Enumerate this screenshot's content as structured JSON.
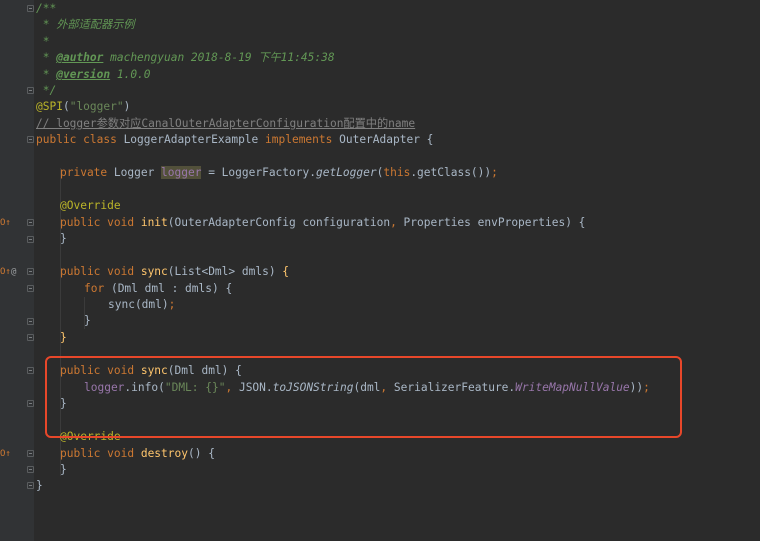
{
  "gutter": {
    "markers": [
      {
        "name": "override-marker-init",
        "text": "O↑"
      },
      {
        "name": "implements-marker-sync",
        "text": "O↑"
      },
      {
        "name": "at-marker-sync",
        "text": "@"
      },
      {
        "name": "override-marker-destroy",
        "text": "O↑"
      }
    ]
  },
  "code": {
    "l1": "/**",
    "l2": " * 外部适配器示例",
    "l3": " *",
    "l4_pre": " * ",
    "l4_tag": "@author",
    "l4_text": " machengyuan 2018-8-19 下午11:45:38",
    "l5_pre": " * ",
    "l5_tag": "@version",
    "l5_text": " 1.0.0",
    "l6": " */",
    "l7_ann": "@SPI",
    "l7_open": "(",
    "l7_str": "\"logger\"",
    "l7_close": ")",
    "l8": "// logger参数对应CanalOuterAdapterConfiguration配置中的name",
    "l9_kw": "public class ",
    "l9_name": "LoggerAdapterExample ",
    "l9_kw2": "implements ",
    "l9_rest": "OuterAdapter {",
    "l11_kw": "private ",
    "l11_type": "Logger ",
    "l11_var": "logger",
    "l11_eq": " = LoggerFactory.",
    "l11_fn": "getLogger",
    "l11_open": "(",
    "l11_this": "this",
    "l11_rest": ".getClass())",
    "l11_semi": ";",
    "l13_ann": "@Override",
    "l14_kw": "public void ",
    "l14_fn": "init",
    "l14_args1": "(OuterAdapterConfig configuration",
    "l14_comma": ", ",
    "l14_args2": "Properties envProperties) {",
    "l15": "}",
    "l17_kw": "public void ",
    "l17_fn": "sync",
    "l17_args": "(List<Dml> dmls) ",
    "l17_brace": "{",
    "l18_kw": "for ",
    "l18_rest": "(Dml dml : dmls) {",
    "l19_call": "sync(dml)",
    "l19_semi": ";",
    "l20": "}",
    "l21": "}",
    "l23_kw": "public void ",
    "l23_fn": "sync",
    "l23_args": "(Dml dml) {",
    "l24_obj": "logger",
    "l24_call": ".info(",
    "l24_str": "\"DML: {}\"",
    "l24_comma": ", ",
    "l24_json": "JSON.",
    "l24_fn": "toJSONString",
    "l24_dml": "(dml",
    "l24_comma2": ", ",
    "l24_sf": "SerializerFeature.",
    "l24_field": "WriteMapNullValue",
    "l24_close": "))",
    "l24_semi": ";",
    "l25": "}",
    "l27_ann": "@Override",
    "l28_kw": "public void ",
    "l28_fn": "destroy",
    "l28_rest": "() {",
    "l29": "}",
    "l30": "}"
  },
  "colors": {
    "background": "#2b2b2b",
    "keyword": "#cc7832",
    "string": "#6a8759",
    "annotation": "#bbb529",
    "method": "#ffc66d",
    "field": "#9876aa",
    "highlight_box": "#e8472a"
  }
}
